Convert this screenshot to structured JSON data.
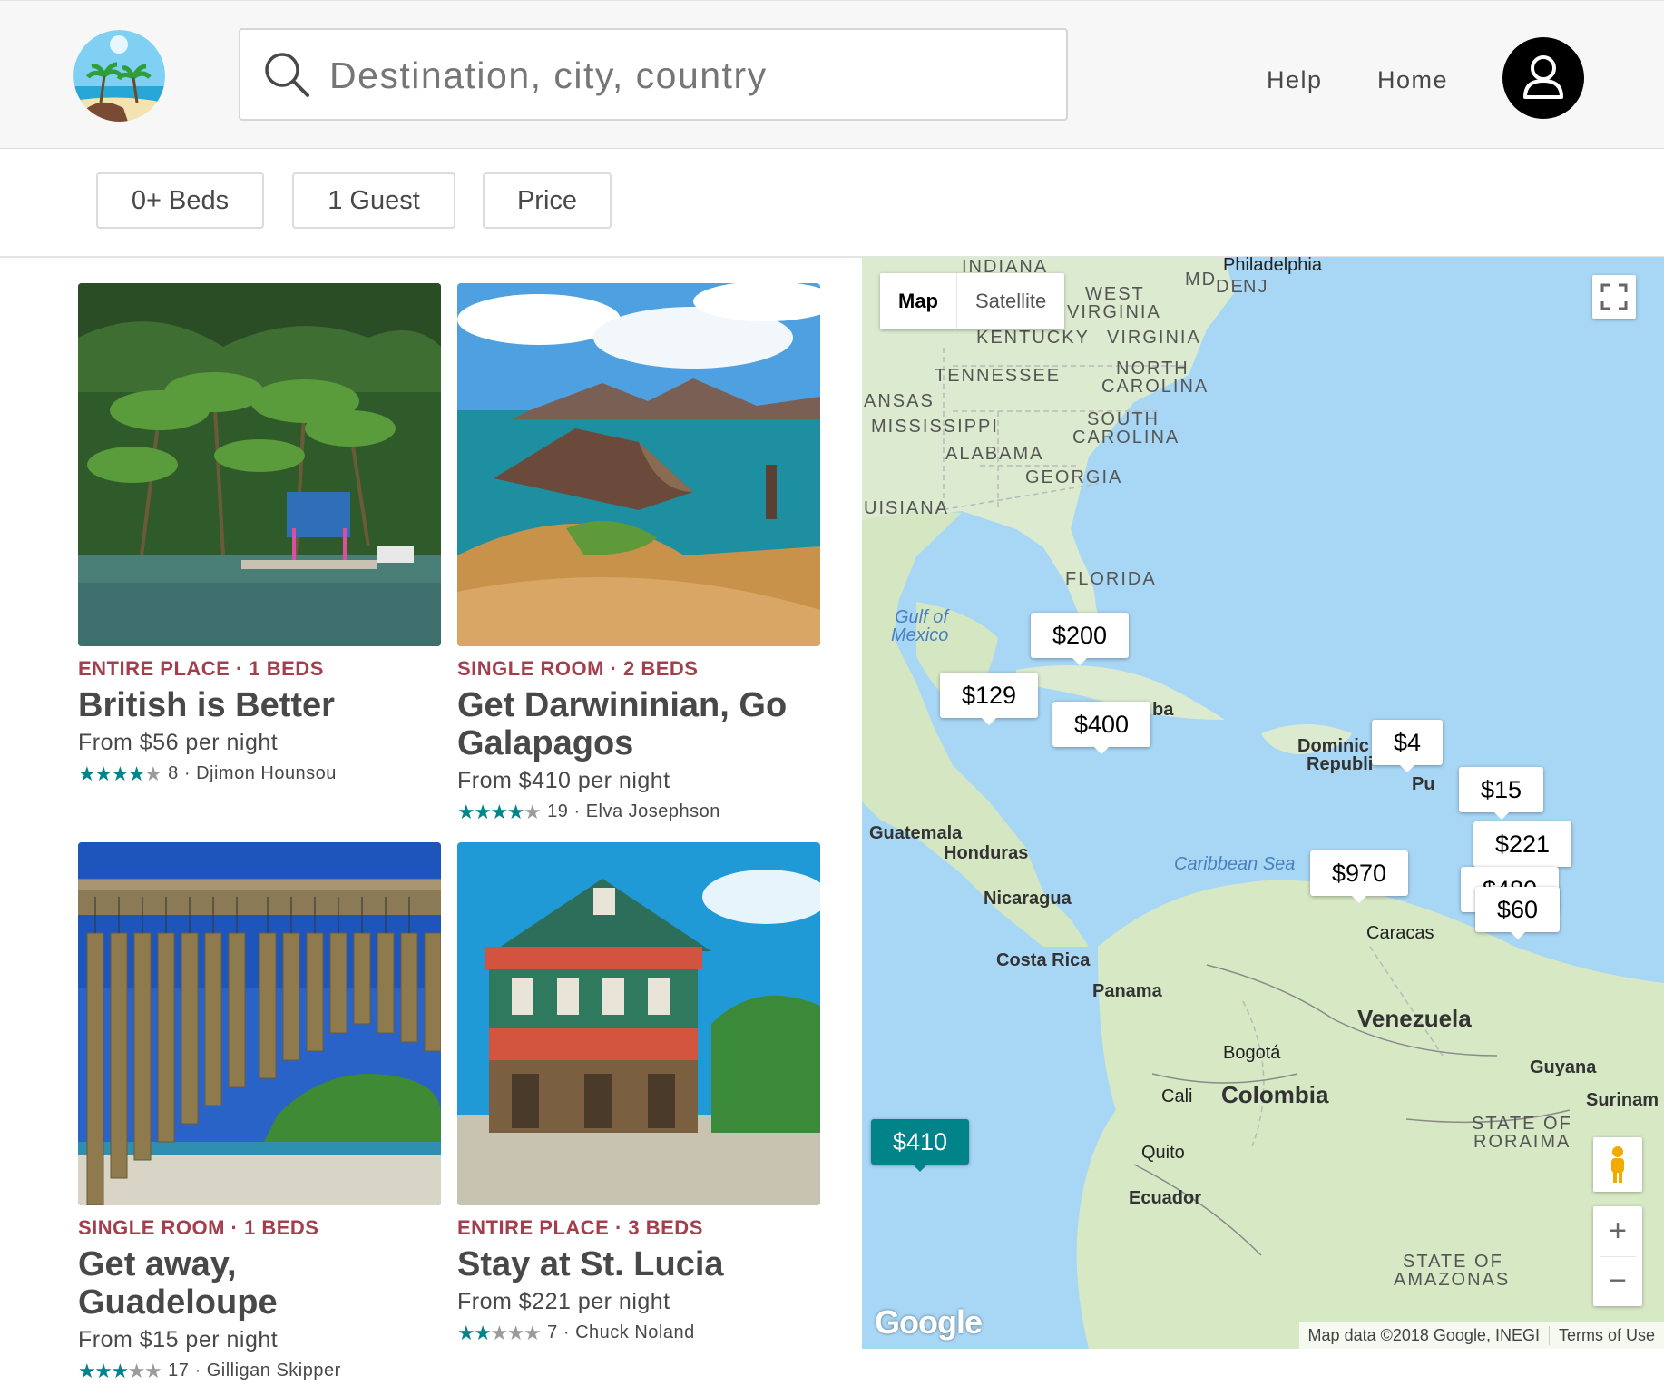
{
  "header": {
    "logo_icon": "tropical-beach-icon",
    "search_placeholder": "Destination, city, country",
    "search_value": "",
    "nav": {
      "help": "Help",
      "home": "Home"
    },
    "avatar_icon": "user-icon"
  },
  "filters": {
    "beds": "0+ Beds",
    "guests": "1 Guest",
    "price": "Price"
  },
  "listings": [
    {
      "type": "ENTIRE PLACE · 1 BEDS",
      "title": "British is Better",
      "price": "From $56 per night",
      "rating": 4,
      "reviews": "8",
      "host": "Djimon Hounsou",
      "photo": "palm-beach-dock"
    },
    {
      "type": "SINGLE ROOM · 2 BEDS",
      "title": "Get Darwininian, Go Galapagos",
      "price": "From $410 per night",
      "rating": 4,
      "reviews": "19",
      "host": "Elva Josephson",
      "photo": "galapagos-islands"
    },
    {
      "type": "SINGLE ROOM · 1 BEDS",
      "title": "Get away, Guadeloupe",
      "price": "From $15 per night",
      "rating": 3,
      "reviews": "17",
      "host": "Gilligan Skipper",
      "photo": "wind-chimes"
    },
    {
      "type": "ENTIRE PLACE · 3 BEDS",
      "title": "Stay at St. Lucia",
      "price": "From $221 per night",
      "rating": 2,
      "reviews": "7",
      "host": "Chuck Noland",
      "photo": "colorful-house"
    }
  ],
  "separator": " · ",
  "map": {
    "type_map": "Map",
    "type_satellite": "Satellite",
    "markers": [
      {
        "label": "$200",
        "selected": false
      },
      {
        "label": "$129",
        "selected": false
      },
      {
        "label": "$400",
        "selected": false
      },
      {
        "label": "$4",
        "selected": false
      },
      {
        "label": "$15",
        "selected": false
      },
      {
        "label": "$221",
        "selected": false
      },
      {
        "label": "$970",
        "selected": false
      },
      {
        "label": "$480",
        "selected": false
      },
      {
        "label": "$60",
        "selected": false
      },
      {
        "label": "$410",
        "selected": true
      }
    ],
    "labels": {
      "indiana": "INDIANA",
      "philadelphia": "Philadelphia",
      "md": "MD",
      "de": "DE",
      "nj": "NJ",
      "west_virginia_1": "WEST",
      "west_virginia_2": "VIRGINIA",
      "kentucky": "KENTUCKY",
      "virginia": "VIRGINIA",
      "tennessee": "TENNESSEE",
      "north_carolina_1": "NORTH",
      "north_carolina_2": "CAROLINA",
      "arkansas": "ANSAS",
      "mississippi": "MISSISSIPPI",
      "south_carolina_1": "SOUTH",
      "south_carolina_2": "CAROLINA",
      "alabama": "ALABAMA",
      "georgia": "GEORGIA",
      "louisiana": "UISIANA",
      "florida": "FLORIDA",
      "gulf_1": "Gulf of",
      "gulf_2": "Mexico",
      "cuba": "ba",
      "dominican_1": "Dominic",
      "dominican_2": "Republi",
      "puerto": "Pu",
      "guatemala": "Guatemala",
      "honduras": "Honduras",
      "nicaragua": "Nicaragua",
      "caribbean": "Caribbean Sea",
      "caracas": "Caracas",
      "costa_rica": "Costa Rica",
      "panama": "Panama",
      "venezuela": "Venezuela",
      "bogota": "Bogotá",
      "guyana": "Guyana",
      "suriname": "Surinam",
      "cali": "Cali",
      "colombia": "Colombia",
      "roraima_1": "STATE OF",
      "roraima_2": "RORAIMA",
      "quito": "Quito",
      "ecuador": "Ecuador",
      "amazonas_1": "STATE OF",
      "amazonas_2": "AMAZONAS"
    },
    "google_logo": "Google",
    "attribution": "Map data ©2018 Google, INEGI",
    "terms": "Terms of Use",
    "zoom_in": "+",
    "zoom_out": "−",
    "fullscreen_icon": "fullscreen-icon",
    "pegman_icon": "pegman-icon"
  }
}
